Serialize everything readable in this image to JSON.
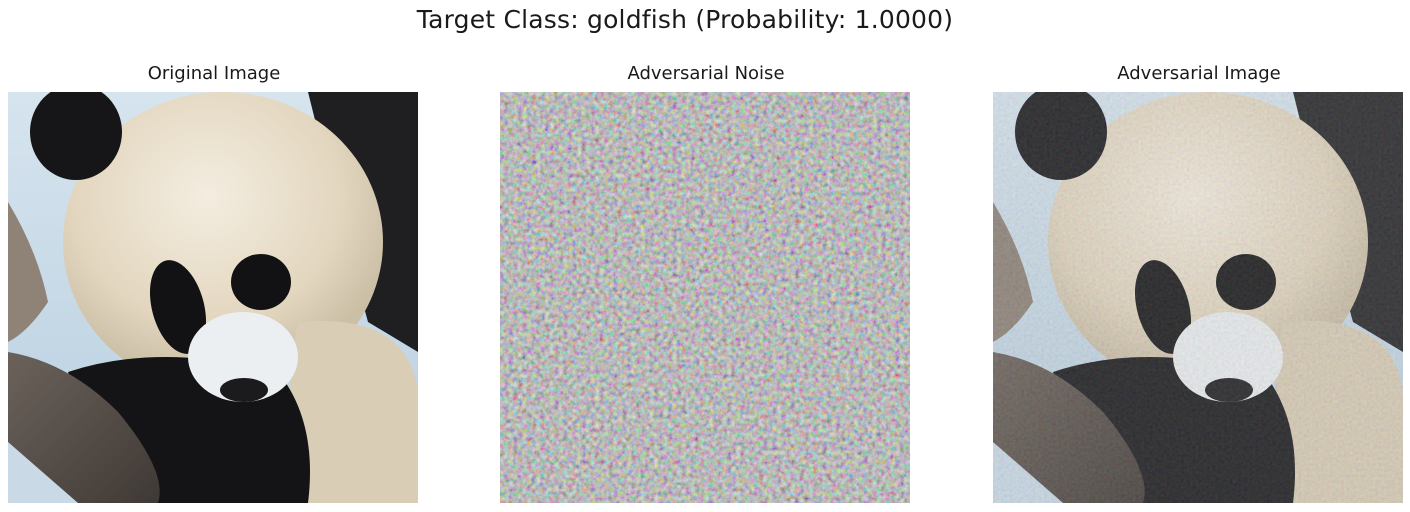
{
  "figure": {
    "suptitle": "Target Class: goldfish (Probability: 1.0000)"
  },
  "panels": [
    {
      "title": "Original Image"
    },
    {
      "title": "Adversarial Noise"
    },
    {
      "title": "Adversarial Image"
    }
  ]
}
